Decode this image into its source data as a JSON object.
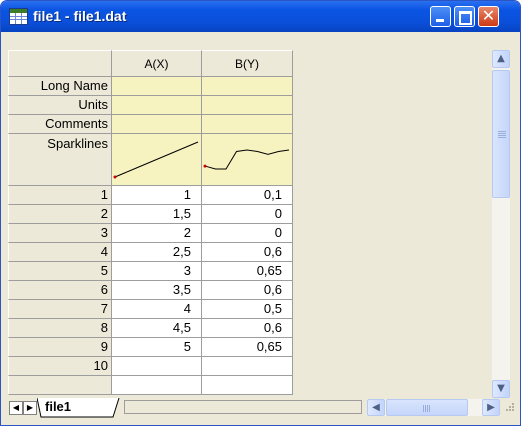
{
  "window": {
    "title": "file1 - file1.dat"
  },
  "worksheet": {
    "columns": [
      "A(X)",
      "B(Y)"
    ],
    "meta_rows": [
      "Long Name",
      "Units",
      "Comments",
      "Sparklines"
    ],
    "rows": [
      {
        "index": "1",
        "a": "1",
        "b": "0,1"
      },
      {
        "index": "2",
        "a": "1,5",
        "b": "0"
      },
      {
        "index": "3",
        "a": "2",
        "b": "0"
      },
      {
        "index": "4",
        "a": "2,5",
        "b": "0,6"
      },
      {
        "index": "5",
        "a": "3",
        "b": "0,65"
      },
      {
        "index": "6",
        "a": "3,5",
        "b": "0,6"
      },
      {
        "index": "7",
        "a": "4",
        "b": "0,5"
      },
      {
        "index": "8",
        "a": "4,5",
        "b": "0,6"
      },
      {
        "index": "9",
        "a": "5",
        "b": "0,65"
      },
      {
        "index": "10",
        "a": "",
        "b": ""
      }
    ],
    "sparkline_a": [
      1,
      1.5,
      2,
      2.5,
      3,
      3.5,
      4,
      4.5,
      5
    ],
    "sparkline_b": [
      0.1,
      0,
      0,
      0.6,
      0.65,
      0.6,
      0.5,
      0.6,
      0.65
    ]
  },
  "tabs": {
    "active": "file1"
  },
  "colors": {
    "meta_cell": "#f6f3c0",
    "sparkline": "#000000",
    "sparkline_start": "#cc0000"
  },
  "icons": [
    "worksheet-icon",
    "minimize-icon",
    "maximize-icon",
    "close-icon",
    "scroll-up-icon",
    "scroll-down-icon",
    "scroll-left-icon",
    "scroll-right-icon",
    "tab-prev-icon",
    "tab-next-icon",
    "resize-grip-icon"
  ]
}
